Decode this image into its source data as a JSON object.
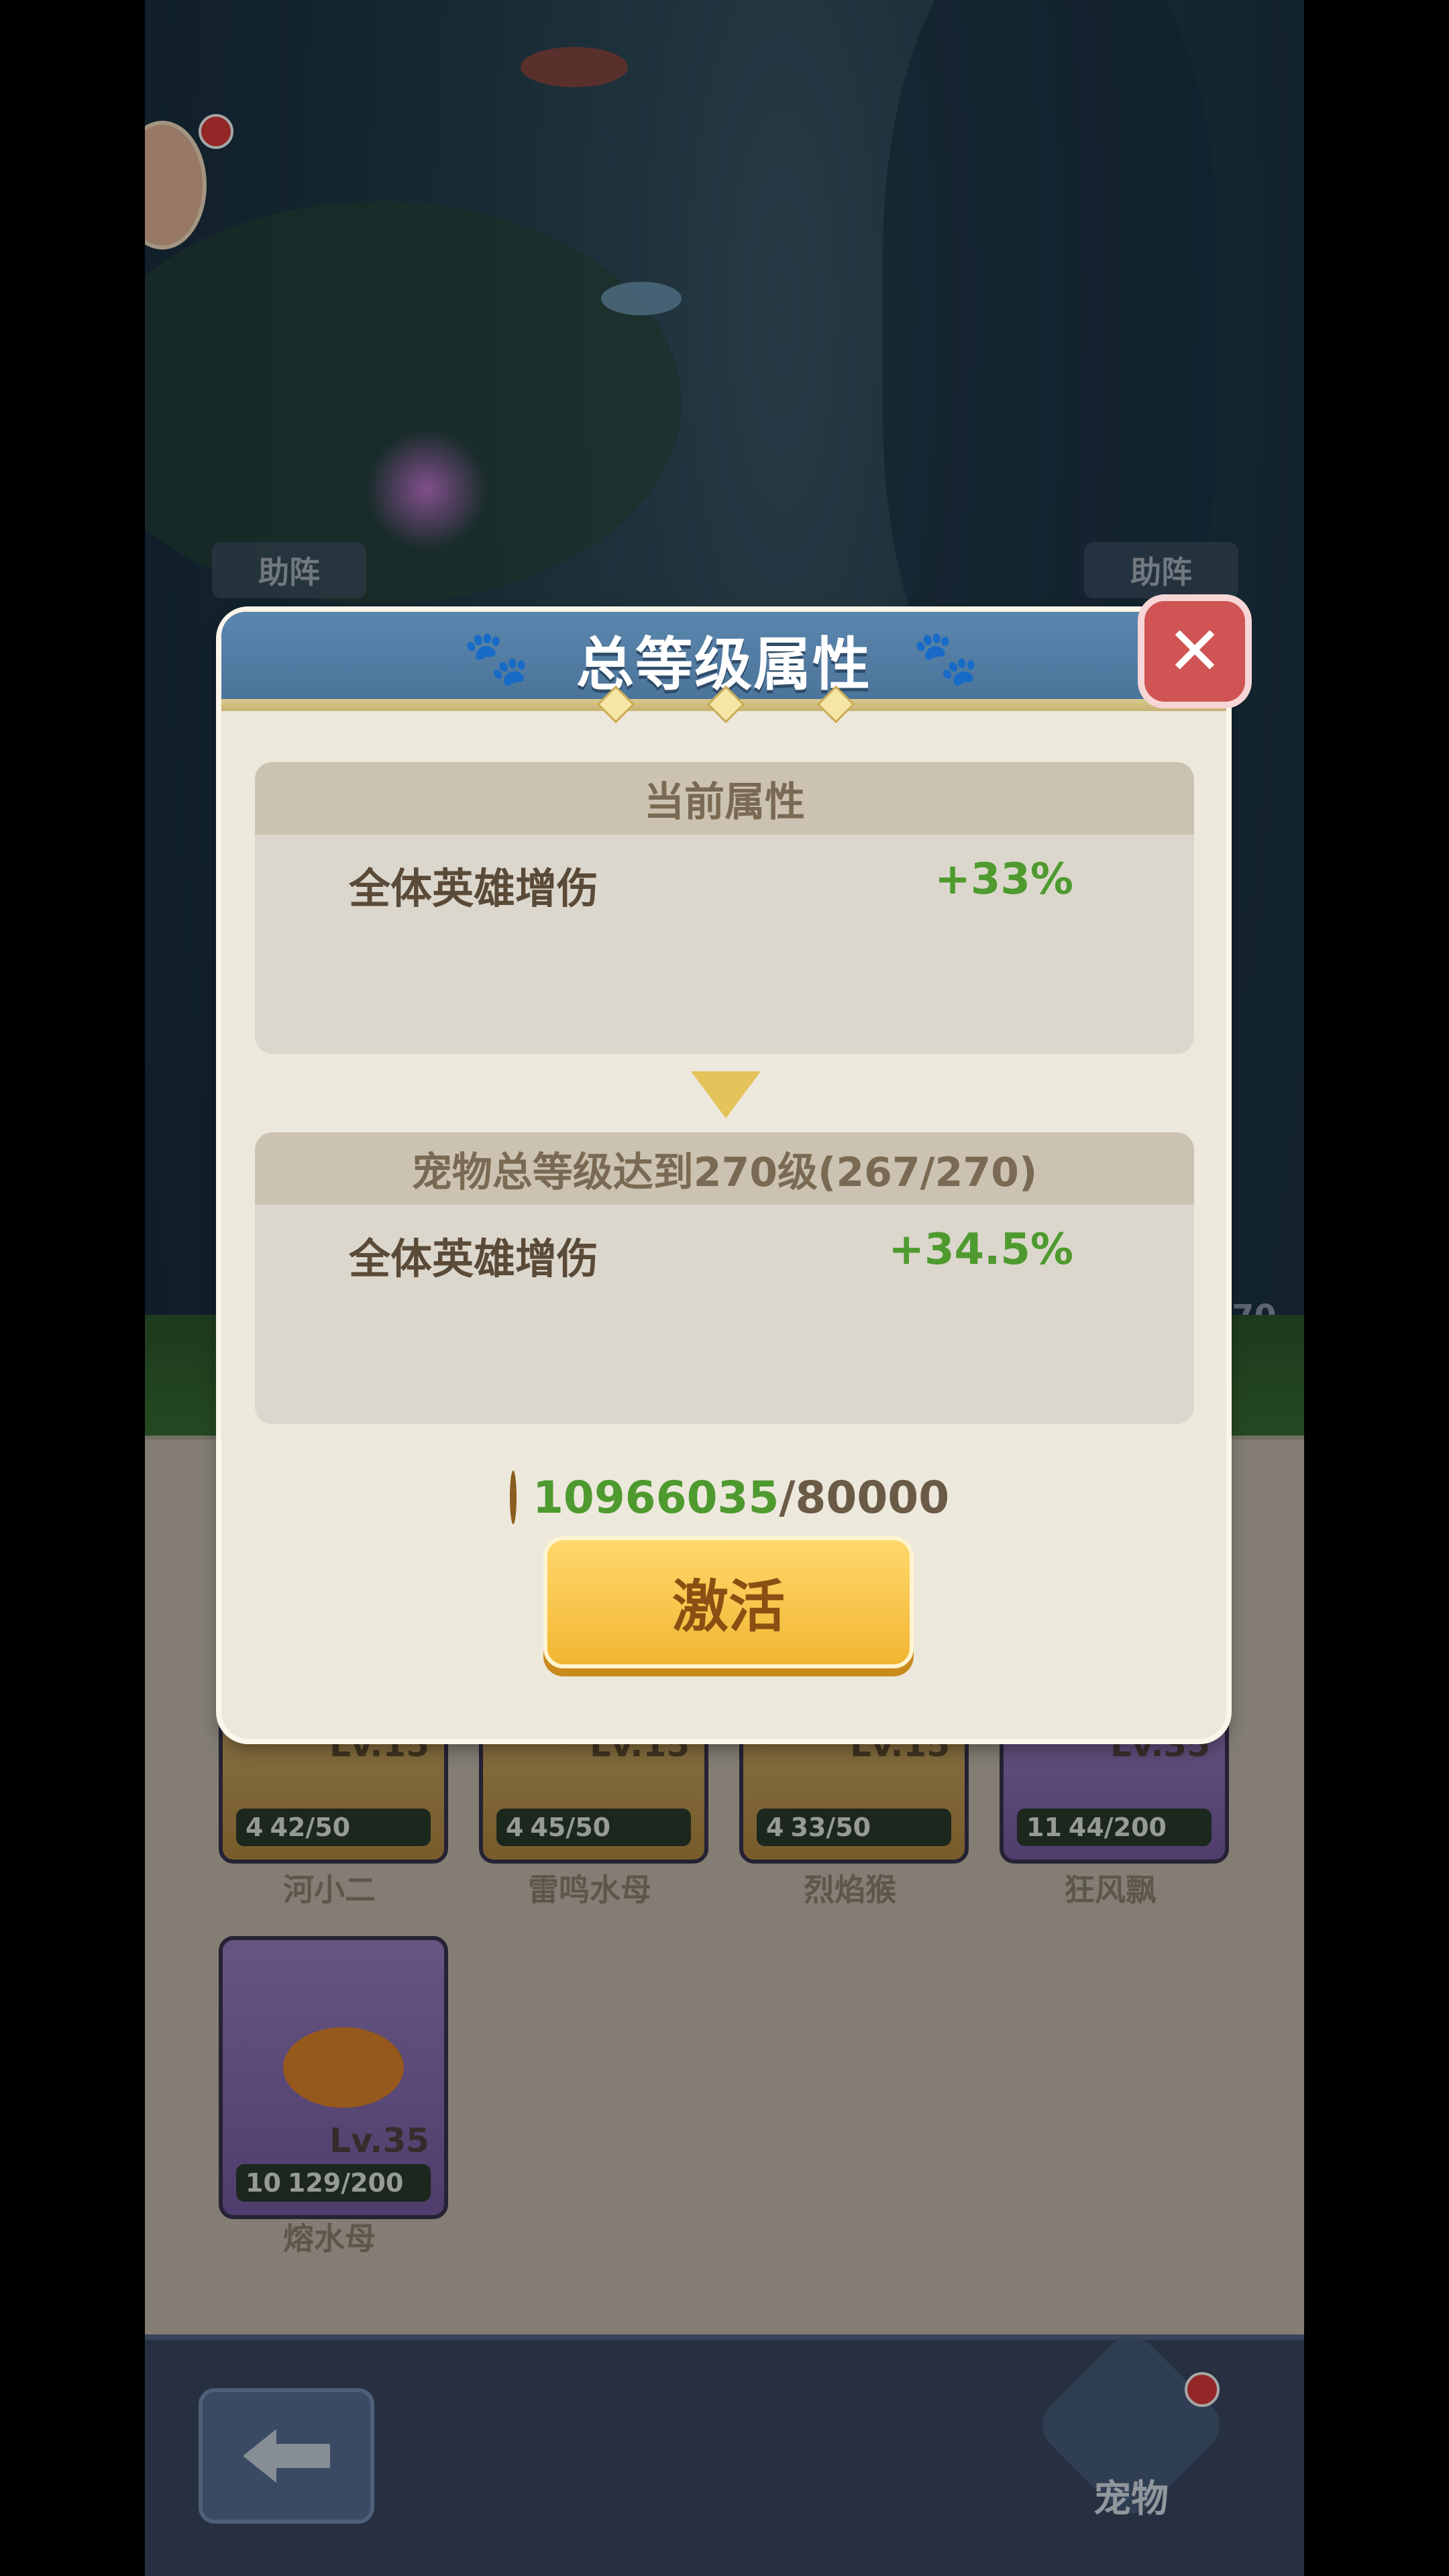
{
  "screen": {
    "side_labels": [
      "助阵",
      "助阵"
    ],
    "side_number": "70"
  },
  "pet_cards": [
    {
      "name": "河小二",
      "level": "Lv.15",
      "stars": "4",
      "progress": "42/50",
      "rarity": "gold"
    },
    {
      "name": "雷鸣水母",
      "level": "Lv.15",
      "stars": "4",
      "progress": "45/50",
      "rarity": "gold"
    },
    {
      "name": "烈焰猴",
      "level": "Lv.15",
      "stars": "4",
      "progress": "33/50",
      "rarity": "gold"
    },
    {
      "name": "狂风飘",
      "level": "Lv.35",
      "stars": "11",
      "progress": "44/200",
      "rarity": "purple"
    },
    {
      "name": "熔水母",
      "level": "Lv.35",
      "stars": "10",
      "progress": "129/200",
      "rarity": "purple"
    }
  ],
  "modal": {
    "title": "总等级属性",
    "current": {
      "header": "当前属性",
      "attr_label": "全体英雄增伤",
      "attr_value": "+33%"
    },
    "next": {
      "header": "宠物总等级达到270级(267/270)",
      "attr_label": "全体英雄增伤",
      "attr_value": "+34.5%"
    },
    "cost_have": "10966035",
    "cost_need": "/80000",
    "activate_label": "激活"
  },
  "bottom": {
    "pet_tab_label": "宠物"
  },
  "colors": {
    "accent_green": "#4e9a2f",
    "header_blue": "#5b86ad",
    "button_yellow": "#f2b632",
    "close_red": "#d05454"
  }
}
